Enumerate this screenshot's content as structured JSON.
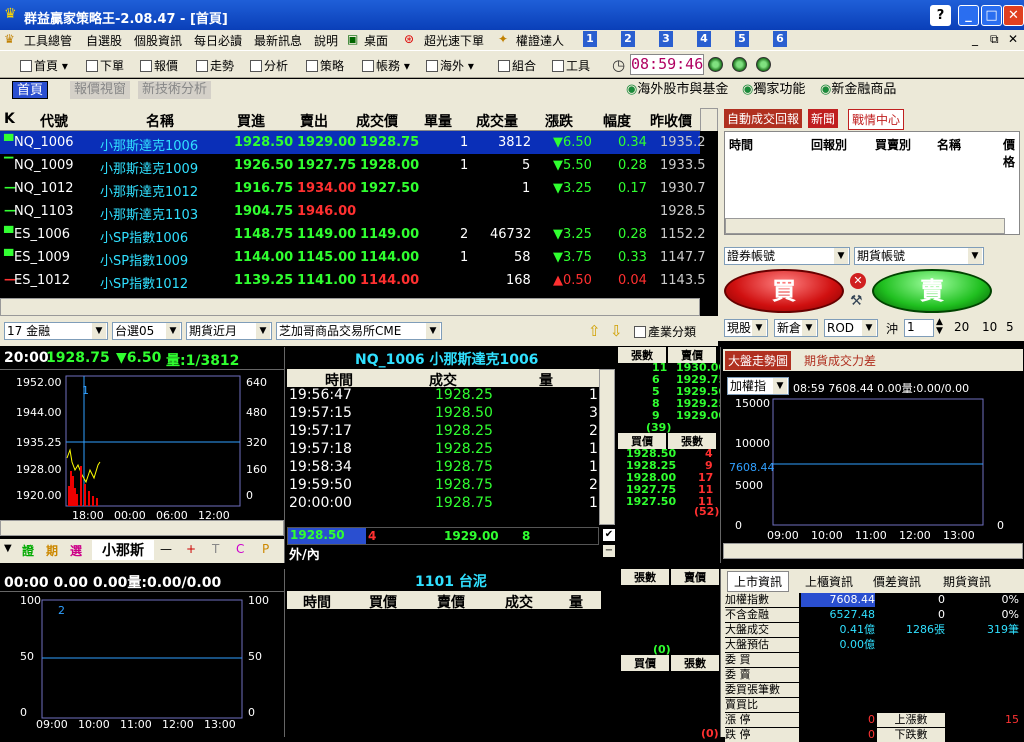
{
  "app": {
    "title": "群益贏家策略王-2.08.47 - [首頁]"
  },
  "menu": [
    "工具總管",
    "自選股",
    "個股資訊",
    "每日必讀",
    "最新訊息",
    "說明",
    "桌面",
    "超光速下單",
    "權證達人"
  ],
  "menu_nums": [
    "1",
    "2",
    "3",
    "4",
    "5",
    "6"
  ],
  "toolbar": {
    "items": [
      "首頁",
      "下單",
      "報價",
      "走勢",
      "分析",
      "策略",
      "帳務",
      "海外",
      "組合",
      "工具"
    ],
    "clock": "08:59:46"
  },
  "tabs": {
    "left": [
      "首頁",
      "報價視窗",
      "新技術分析"
    ],
    "right": [
      "海外股市與基金",
      "獨家功能",
      "新金融商品"
    ]
  },
  "quote": {
    "headers": [
      "K",
      "代號",
      "名稱",
      "買進",
      "賣出",
      "成交價",
      "單量",
      "成交量",
      "漲跌",
      "幅度",
      "昨收價"
    ],
    "rows": [
      {
        "code": "NQ_1006",
        "name": "小那斯達克1006",
        "bid": "1928.50",
        "ask": "1929.00",
        "last": "1928.75",
        "vol1": "1",
        "vol": "3812",
        "chg": "6.50",
        "dir": "down",
        "pct": "0.34",
        "prev": "1935.2"
      },
      {
        "code": "NQ_1009",
        "name": "小那斯達克1009",
        "bid": "1926.50",
        "ask": "1927.75",
        "last": "1928.00",
        "vol1": "1",
        "vol": "5",
        "chg": "5.50",
        "dir": "down",
        "pct": "0.28",
        "prev": "1933.5"
      },
      {
        "code": "NQ_1012",
        "name": "小那斯達克1012",
        "bid": "1916.75",
        "ask": "1934.00",
        "last": "1927.50",
        "vol1": "",
        "vol": "1",
        "chg": "3.25",
        "dir": "down",
        "pct": "0.17",
        "prev": "1930.7"
      },
      {
        "code": "NQ_1103",
        "name": "小那斯達克1103",
        "bid": "1904.75",
        "ask": "1946.00",
        "last": "",
        "vol1": "",
        "vol": "",
        "chg": "",
        "dir": "",
        "pct": "",
        "prev": "1928.5"
      },
      {
        "code": "ES_1006",
        "name": "小SP指數1006",
        "bid": "1148.75",
        "ask": "1149.00",
        "last": "1149.00",
        "vol1": "2",
        "vol": "46732",
        "chg": "3.25",
        "dir": "down",
        "pct": "0.28",
        "prev": "1152.2"
      },
      {
        "code": "ES_1009",
        "name": "小SP指數1009",
        "bid": "1144.00",
        "ask": "1145.00",
        "last": "1144.00",
        "vol1": "1",
        "vol": "58",
        "chg": "3.75",
        "dir": "down",
        "pct": "0.33",
        "prev": "1147.7"
      },
      {
        "code": "ES_1012",
        "name": "小SP指數1012",
        "bid": "1139.25",
        "ask": "1141.00",
        "last": "1144.00",
        "vol1": "",
        "vol": "168",
        "chg": "0.50",
        "dir": "up",
        "pct": "0.04",
        "prev": "1143.5"
      }
    ]
  },
  "filters": [
    "17 金融",
    "台選05",
    "期貨近月",
    "芝加哥商品交易所CME"
  ],
  "filter_btn": "產業分類",
  "right_top": {
    "tabs": [
      "自動成交回報",
      "新聞",
      "戰情中心"
    ],
    "cols": [
      "時間",
      "回報別",
      "買賣別",
      "名稱",
      "價格"
    ]
  },
  "order": {
    "acct1": "證券帳號",
    "acct2": "期貨帳號",
    "buy": "買",
    "sell": "賣",
    "type": "現股",
    "new": "新倉",
    "rod": "ROD",
    "sub": "沖",
    "qty": "1",
    "q": [
      "20",
      "10",
      "5"
    ]
  },
  "chart1": {
    "header": "20:00",
    "price": "1928.75",
    "chg": "6.50",
    "vol": "量:1/3812",
    "yl": [
      "1952.00",
      "1944.00",
      "1935.25",
      "1928.00",
      "1920.00"
    ],
    "yr": [
      "640",
      "480",
      "320",
      "160",
      "0"
    ],
    "xt": [
      "18:00",
      "00:00",
      "06:00",
      "12:00"
    ],
    "marker": "1"
  },
  "ticks": {
    "title": "NQ_1006 小那斯達克1006",
    "cols": [
      "時間",
      "成交",
      "量"
    ],
    "rows": [
      [
        "19:56:47",
        "1928.25",
        "1"
      ],
      [
        "19:57:15",
        "1928.50",
        "3"
      ],
      [
        "19:57:17",
        "1928.25",
        "2"
      ],
      [
        "19:57:18",
        "1928.25",
        "1"
      ],
      [
        "19:58:34",
        "1928.75",
        "1"
      ],
      [
        "19:59:50",
        "1928.75",
        "2"
      ],
      [
        "20:00:00",
        "1928.75",
        "1"
      ]
    ],
    "bid": "1928.50",
    "bidq": "4",
    "ask": "1929.00",
    "askq": "8",
    "io": "外/內"
  },
  "depth": {
    "h1": "張數",
    "h2": "賣價",
    "asks": [
      [
        "11",
        "1930.00"
      ],
      [
        "6",
        "1929.75"
      ],
      [
        "5",
        "1929.50"
      ],
      [
        "8",
        "1929.25"
      ],
      [
        "9",
        "1929.00"
      ]
    ],
    "ask_total": "(39)",
    "h3": "買價",
    "h4": "張數",
    "bids": [
      [
        "1928.50",
        "4"
      ],
      [
        "1928.25",
        "9"
      ],
      [
        "1928.00",
        "17"
      ],
      [
        "1927.75",
        "11"
      ],
      [
        "1927.50",
        "11"
      ]
    ],
    "bid_total": "(52)"
  },
  "chart_toolbar": {
    "items": [
      "證",
      "期",
      "選"
    ],
    "name": "小那斯",
    "ops": [
      "—",
      "+",
      "T",
      "C",
      "P"
    ]
  },
  "mkt": {
    "tabs": [
      "大盤走勢圖",
      "期貨成交力差"
    ],
    "sel": "加權指",
    "info": "08:59 7608.44  0.00量:0.00/0.00",
    "yl": [
      "15000",
      "10000",
      "7608.44",
      "5000",
      "0"
    ],
    "xt": [
      "09:00",
      "10:00",
      "11:00",
      "12:00",
      "13:00"
    ]
  },
  "chart2": {
    "header": "00:00  0.00 0.00量:0.00/0.00",
    "yl": [
      "100",
      "50",
      "0"
    ],
    "yr": [
      "100",
      "50",
      "0"
    ],
    "xt": [
      "09:00",
      "10:00",
      "11:00",
      "12:00",
      "13:00"
    ],
    "marker": "2"
  },
  "ticks2": {
    "title": "1101 台泥",
    "cols": [
      "時間",
      "買價",
      "賣價",
      "成交",
      "量"
    ],
    "h1": "張數",
    "h2": "賣價",
    "h3": "買價",
    "h4": "張數",
    "t1": "(0)",
    "t2": "(0)"
  },
  "stats": {
    "tabs": [
      "上市資訊",
      "上櫃資訊",
      "價差資訊",
      "期貨資訊"
    ],
    "rows": [
      [
        "加權指數",
        "7608.44",
        "0",
        "0%"
      ],
      [
        "不含金融",
        "6527.48",
        "0",
        "0%"
      ],
      [
        "大盤成交",
        "0.41億",
        "1286張",
        "319筆"
      ],
      [
        "大盤預估",
        "0.00億",
        "",
        ""
      ],
      [
        "委 買",
        "",
        "",
        ""
      ],
      [
        "委 賣",
        "",
        "",
        ""
      ],
      [
        "委買張筆數",
        "",
        "",
        ""
      ],
      [
        "賣買比",
        "",
        "",
        ""
      ],
      [
        "漲 停",
        "0",
        "上漲數",
        "15"
      ],
      [
        "跌 停",
        "0",
        "下跌數",
        ""
      ]
    ]
  }
}
